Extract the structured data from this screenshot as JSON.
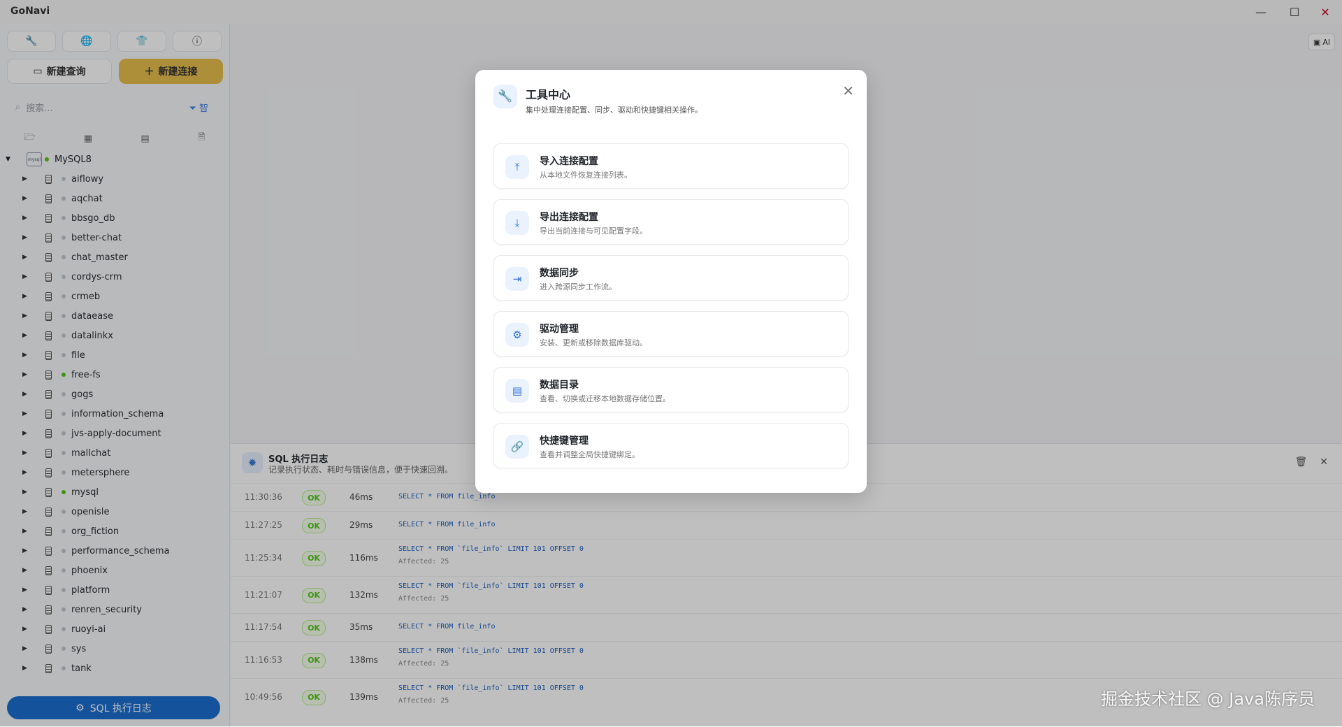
{
  "app": {
    "title": "GoNavi"
  },
  "window_controls": {
    "minimize": "—",
    "maximize": "☐",
    "close": "✕"
  },
  "sidebar": {
    "toolbar_icons": [
      "wrench-icon",
      "globe-icon",
      "shirt-icon",
      "info-icon"
    ],
    "new_query": "新建查询",
    "new_connection": "新建连接",
    "search_placeholder": "搜索...",
    "filter_label": "智",
    "connection": {
      "name": "MySQL8",
      "badge": "mysql"
    },
    "databases": [
      {
        "name": "aiflowy",
        "active": false
      },
      {
        "name": "aqchat",
        "active": false
      },
      {
        "name": "bbsgo_db",
        "active": false
      },
      {
        "name": "better-chat",
        "active": false
      },
      {
        "name": "chat_master",
        "active": false
      },
      {
        "name": "cordys-crm",
        "active": false
      },
      {
        "name": "crmeb",
        "active": false
      },
      {
        "name": "dataease",
        "active": false
      },
      {
        "name": "datalinkx",
        "active": false
      },
      {
        "name": "file",
        "active": false
      },
      {
        "name": "free-fs",
        "active": true
      },
      {
        "name": "gogs",
        "active": false
      },
      {
        "name": "information_schema",
        "active": false
      },
      {
        "name": "jvs-apply-document",
        "active": false
      },
      {
        "name": "mallchat",
        "active": false
      },
      {
        "name": "metersphere",
        "active": false
      },
      {
        "name": "mysql",
        "active": true
      },
      {
        "name": "openisle",
        "active": false
      },
      {
        "name": "org_fiction",
        "active": false
      },
      {
        "name": "performance_schema",
        "active": false
      },
      {
        "name": "phoenix",
        "active": false
      },
      {
        "name": "platform",
        "active": false
      },
      {
        "name": "renren_security",
        "active": false
      },
      {
        "name": "ruoyi-ai",
        "active": false
      },
      {
        "name": "sys",
        "active": false
      },
      {
        "name": "tank",
        "active": false
      }
    ],
    "log_button": "SQL 执行日志"
  },
  "ai_button": "AI",
  "log_panel": {
    "title": "SQL 执行日志",
    "subtitle": "记录执行状态、耗时与错误信息，便于快速回溯。",
    "entries": [
      {
        "time": "11:30:36",
        "status": "OK",
        "ms": "46ms",
        "sql": "SELECT * FROM file_info",
        "affected": ""
      },
      {
        "time": "11:27:25",
        "status": "OK",
        "ms": "29ms",
        "sql": "SELECT * FROM file_info",
        "affected": ""
      },
      {
        "time": "11:25:34",
        "status": "OK",
        "ms": "116ms",
        "sql": "SELECT * FROM `file_info` LIMIT 101 OFFSET 0",
        "affected": "Affected: 25"
      },
      {
        "time": "11:21:07",
        "status": "OK",
        "ms": "132ms",
        "sql": "SELECT * FROM `file_info` LIMIT 101 OFFSET 0",
        "affected": "Affected: 25"
      },
      {
        "time": "11:17:54",
        "status": "OK",
        "ms": "35ms",
        "sql": "SELECT * FROM file_info",
        "affected": ""
      },
      {
        "time": "11:16:53",
        "status": "OK",
        "ms": "138ms",
        "sql": "SELECT * FROM `file_info` LIMIT 101 OFFSET 0",
        "affected": "Affected: 25"
      },
      {
        "time": "10:49:56",
        "status": "OK",
        "ms": "139ms",
        "sql": "SELECT * FROM `file_info` LIMIT 101 OFFSET 0",
        "affected": "Affected: 25"
      }
    ]
  },
  "modal": {
    "title": "工具中心",
    "subtitle": "集中处理连接配置、同步、驱动和快捷键相关操作。",
    "items": [
      {
        "title": "导入连接配置",
        "desc": "从本地文件恢复连接列表。",
        "icon": "upload-icon"
      },
      {
        "title": "导出连接配置",
        "desc": "导出当前连接与可见配置字段。",
        "icon": "download-icon"
      },
      {
        "title": "数据同步",
        "desc": "进入跨源同步工作流。",
        "icon": "sync-icon"
      },
      {
        "title": "驱动管理",
        "desc": "安装、更新或移除数据库驱动。",
        "icon": "gear-icon"
      },
      {
        "title": "数据目录",
        "desc": "查看、切换或迁移本地数据存储位置。",
        "icon": "folder-icon"
      },
      {
        "title": "快捷键管理",
        "desc": "查看并调整全局快捷键绑定。",
        "icon": "link-icon"
      }
    ]
  },
  "watermark": "掘金技术社区 @ Java陈序员"
}
